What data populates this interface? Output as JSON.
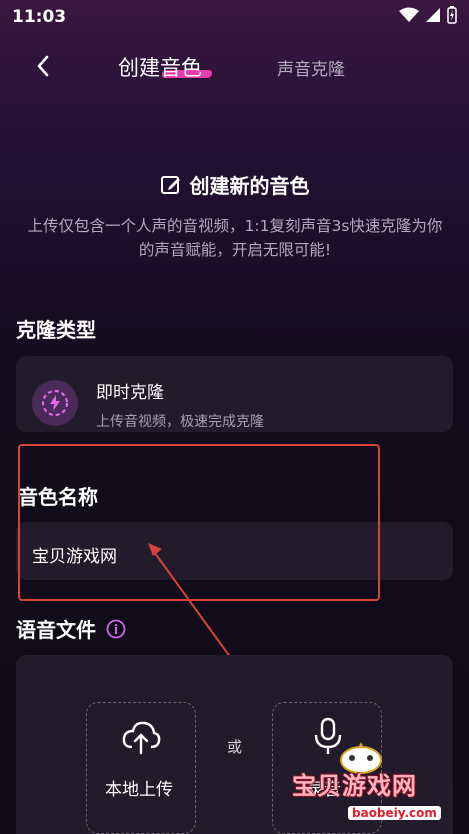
{
  "status_bar": {
    "time": "11:03"
  },
  "nav": {
    "active_tab": "创建音色",
    "inactive_tab": "声音克隆"
  },
  "hero": {
    "title": "创建新的音色",
    "description": "上传仅包含一个人声的音视频，1:1复刻声音3s快速克隆为你的声音赋能，开启无限可能!"
  },
  "clone_type": {
    "section_title": "克隆类型",
    "option_name": "即时克隆",
    "option_desc": "上传音视频，极速完成克隆"
  },
  "voice_name": {
    "section_title": "音色名称",
    "value": "宝贝游戏网"
  },
  "voice_file": {
    "section_title": "语音文件",
    "local_upload_label": "本地上传",
    "or_label": "或",
    "record_label": "录音"
  },
  "watermark": {
    "text": "宝贝游戏网",
    "url": "baobeiy.com"
  },
  "colors": {
    "accent_pink": "#ff3fb8",
    "annotation_red": "#d7423a"
  }
}
